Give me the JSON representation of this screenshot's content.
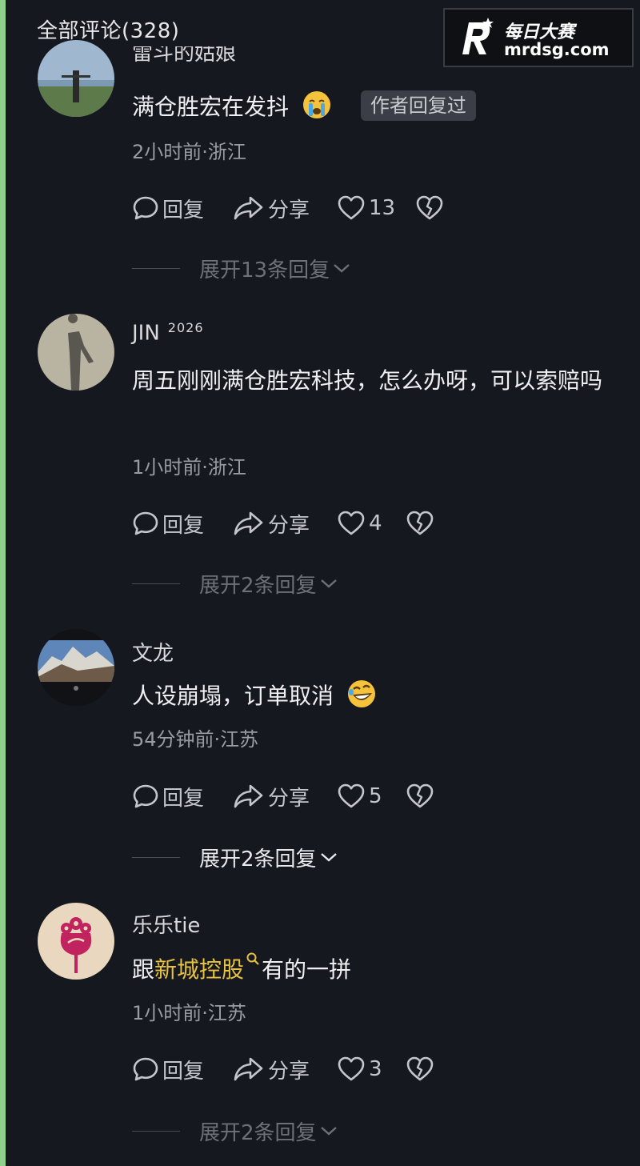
{
  "header": {
    "title": "全部评论(328)"
  },
  "watermark": {
    "cn": "每日大赛",
    "url": "mrdsg.com"
  },
  "actions_labels": {
    "reply": "回复",
    "share": "分享"
  },
  "comments": [
    {
      "username": "雷斗的姑娘",
      "content": "满仓胜宏在发抖",
      "emoji": "crying-face-emoji",
      "author_badge": "作者回复过",
      "meta": "2小时前·浙江",
      "likes": "13",
      "expand": "展开13条回复"
    },
    {
      "username": "JIN",
      "username_sup": "2026",
      "content": "周五刚刚满仓胜宏科技，怎么办呀，可以索赔吗",
      "meta": "1小时前·浙江",
      "likes": "4",
      "expand": "展开2条回复"
    },
    {
      "username": "文龙",
      "content": "人设崩塌，订单取消",
      "emoji": "rolling-laughing-emoji",
      "meta": "54分钟前·江苏",
      "likes": "5",
      "expand": "展开2条回复"
    },
    {
      "username": "乐乐tie",
      "content_prefix": "跟",
      "content_link": "新城控股",
      "content_suffix": "有的一拼",
      "meta": "1小时前·江苏",
      "likes": "3",
      "expand": "展开2条回复"
    }
  ],
  "colors": {
    "background": "#16181f",
    "link": "#e6c23f",
    "meta": "#9a9ca3",
    "author_badge_bg": "#3b3e47"
  }
}
